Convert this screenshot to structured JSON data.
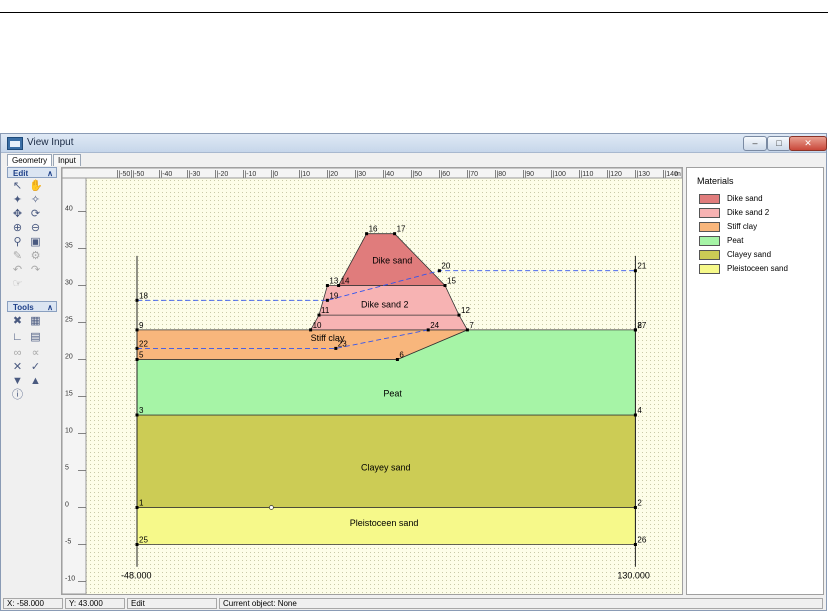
{
  "window": {
    "title": "View Input"
  },
  "tabs": [
    {
      "label": "Geometry"
    },
    {
      "label": "Input"
    }
  ],
  "toolbox": {
    "edit_label": "Edit",
    "tools_label": "Tools"
  },
  "ruler": {
    "x_ticks": [
      "-50",
      "-50",
      "-40",
      "-30",
      "-20",
      "-10",
      "0",
      "10",
      "20",
      "30",
      "40",
      "50",
      "60",
      "70",
      "80",
      "90",
      "100",
      "110",
      "120",
      "130",
      "140"
    ],
    "x_unit": "m",
    "y_ticks": [
      "40",
      "35",
      "30",
      "25",
      "20",
      "15",
      "10",
      "5",
      "0",
      "-5",
      "-10"
    ]
  },
  "model": {
    "left_boundary_label": "-48.000",
    "right_boundary_label": "130.000",
    "layers": [
      {
        "name": "Dike sand",
        "color": "#e07c7c"
      },
      {
        "name": "Dike sand 2",
        "color": "#f7b3b3"
      },
      {
        "name": "Stiff clay",
        "color": "#f8b67c"
      },
      {
        "name": "Peat",
        "color": "#a6f4a6"
      },
      {
        "name": "Clayey sand",
        "color": "#cccc55"
      },
      {
        "name": "Pleistoceen sand",
        "color": "#f6f98a"
      }
    ],
    "points": [
      {
        "id": "1",
        "x": -48,
        "y": 0
      },
      {
        "id": "2",
        "x": 130,
        "y": 0
      },
      {
        "id": "3",
        "x": -48,
        "y": 12.5
      },
      {
        "id": "4",
        "x": 130,
        "y": 12.5
      },
      {
        "id": "5",
        "x": -48,
        "y": 20
      },
      {
        "id": "6",
        "x": 45,
        "y": 20
      },
      {
        "id": "7",
        "x": 70,
        "y": 24
      },
      {
        "id": "8",
        "x": 130,
        "y": 24
      },
      {
        "id": "9",
        "x": -48,
        "y": 24
      },
      {
        "id": "10",
        "x": 14,
        "y": 24
      },
      {
        "id": "11",
        "x": 17,
        "y": 26
      },
      {
        "id": "12",
        "x": 67,
        "y": 26
      },
      {
        "id": "13",
        "x": 20,
        "y": 30
      },
      {
        "id": "14",
        "x": 24,
        "y": 30
      },
      {
        "id": "15",
        "x": 62,
        "y": 30
      },
      {
        "id": "16",
        "x": 34,
        "y": 37
      },
      {
        "id": "17",
        "x": 44,
        "y": 37
      },
      {
        "id": "18",
        "x": -48,
        "y": 28
      },
      {
        "id": "19",
        "x": 20,
        "y": 28
      },
      {
        "id": "20",
        "x": 60,
        "y": 32
      },
      {
        "id": "21",
        "x": 130,
        "y": 32
      },
      {
        "id": "22",
        "x": -48,
        "y": 21.5
      },
      {
        "id": "23",
        "x": 23,
        "y": 21.5
      },
      {
        "id": "24",
        "x": 56,
        "y": 24
      },
      {
        "id": "25",
        "x": -48,
        "y": -5
      },
      {
        "id": "26",
        "x": 130,
        "y": -5
      },
      {
        "id": "27",
        "x": 130,
        "y": 24
      }
    ]
  },
  "legend": {
    "title": "Materials",
    "items": [
      {
        "label": "Dike sand",
        "color": "#e07c7c"
      },
      {
        "label": "Dike sand 2",
        "color": "#f7b3b3"
      },
      {
        "label": "Stiff clay",
        "color": "#f8b67c"
      },
      {
        "label": "Peat",
        "color": "#a6f4a6"
      },
      {
        "label": "Clayey sand",
        "color": "#cccc55"
      },
      {
        "label": "Pleistoceen sand",
        "color": "#f6f98a"
      }
    ]
  },
  "status": {
    "x": "X: -58.000",
    "y": "Y: 43.000",
    "mode": "Edit",
    "current_object": "Current object: None"
  }
}
